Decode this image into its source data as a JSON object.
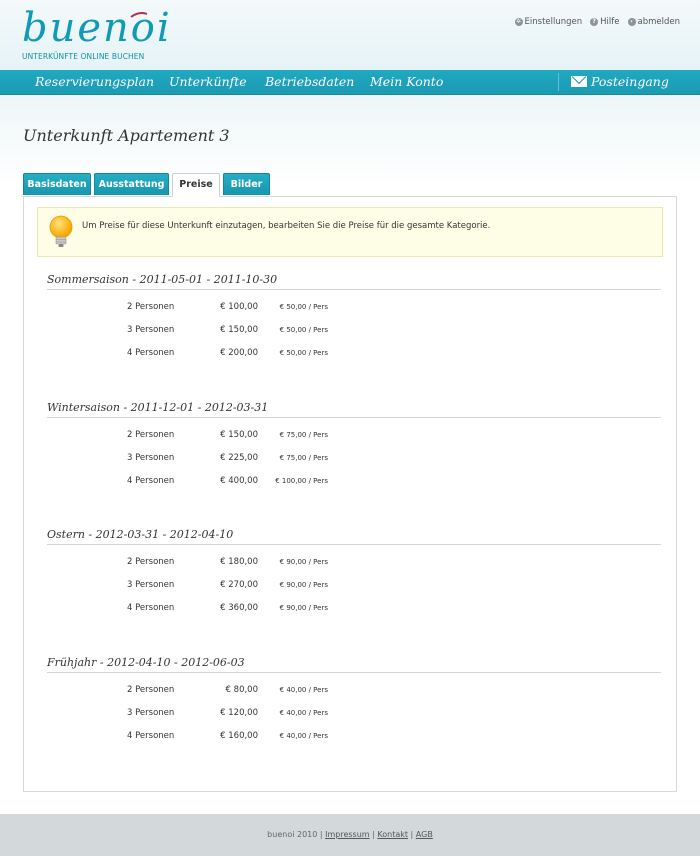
{
  "brand": {
    "name": "buenoi",
    "tagline": "UNTERKÜNFTE ONLINE BUCHEN",
    "accent": "#1b9ab2",
    "mark_color": "#b0324e"
  },
  "util_links": [
    {
      "label": "Einstellungen",
      "icon": "gear-icon"
    },
    {
      "label": "Hilfe",
      "icon": "help-icon"
    },
    {
      "label": "abmelden",
      "icon": "logout-icon"
    }
  ],
  "nav": {
    "items": [
      "Reservierungsplan",
      "Unterkünfte",
      "Betriebsdaten",
      "Mein Konto"
    ],
    "inbox": "Posteingang"
  },
  "page_title": "Unterkunft Apartement 3",
  "tabs": [
    {
      "label": "Basisdaten",
      "active": false
    },
    {
      "label": "Ausstattung",
      "active": false
    },
    {
      "label": "Preise",
      "active": true
    },
    {
      "label": "Bilder",
      "active": false
    }
  ],
  "info_message": "Um Preise für diese Unterkunft einzutagen, bearbeiten Sie die Preise für die gesamte Kategorie.",
  "seasons": [
    {
      "title": "Sommersaison - 2011-05-01 - 2011-10-30",
      "rows": [
        {
          "label": "2 Personen",
          "total": "€ 100,00",
          "per": "€ 50,00 / Pers"
        },
        {
          "label": "3 Personen",
          "total": "€ 150,00",
          "per": "€ 50,00 / Pers"
        },
        {
          "label": "4 Personen",
          "total": "€ 200,00",
          "per": "€ 50,00 / Pers"
        }
      ]
    },
    {
      "title": "Wintersaison - 2011-12-01 - 2012-03-31",
      "rows": [
        {
          "label": "2 Personen",
          "total": "€ 150,00",
          "per": "€ 75,00 / Pers"
        },
        {
          "label": "3 Personen",
          "total": "€ 225,00",
          "per": "€ 75,00 / Pers"
        },
        {
          "label": "4 Personen",
          "total": "€ 400,00",
          "per": "€ 100,00 / Pers"
        }
      ]
    },
    {
      "title": "Ostern - 2012-03-31 - 2012-04-10",
      "rows": [
        {
          "label": "2 Personen",
          "total": "€ 180,00",
          "per": "€ 90,00 / Pers"
        },
        {
          "label": "3 Personen",
          "total": "€ 270,00",
          "per": "€ 90,00 / Pers"
        },
        {
          "label": "4 Personen",
          "total": "€ 360,00",
          "per": "€ 90,00 / Pers"
        }
      ]
    },
    {
      "title": "Frühjahr - 2012-04-10 - 2012-06-03",
      "rows": [
        {
          "label": "2 Personen",
          "total": "€ 80,00",
          "per": "€ 40,00 / Pers"
        },
        {
          "label": "3 Personen",
          "total": "€ 120,00",
          "per": "€ 40,00 / Pers"
        },
        {
          "label": "4 Personen",
          "total": "€ 160,00",
          "per": "€ 40,00 / Pers"
        }
      ]
    }
  ],
  "footer": {
    "copyright": "buenoi 2010",
    "links": [
      "Impressum",
      "Kontakt",
      "AGB"
    ]
  }
}
